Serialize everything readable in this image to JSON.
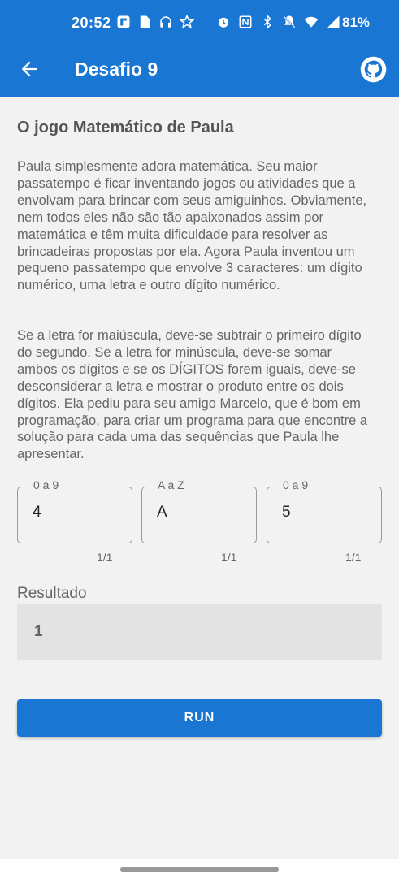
{
  "status_bar": {
    "time": "20:52",
    "battery": "81%",
    "left_icons": [
      "flipboard-icon",
      "document-icon",
      "headset-icon",
      "star-icon"
    ],
    "right_icons": [
      "alarm-icon",
      "nfc-icon",
      "bluetooth-icon",
      "mute-icon",
      "wifi-icon",
      "signal-icon"
    ]
  },
  "app_bar": {
    "title": "Desafio 9",
    "back_icon": "arrow-back-icon",
    "action_icon": "github-icon"
  },
  "challenge": {
    "title": "O jogo Matemático de Paula",
    "paragraph1": "Paula simplesmente adora matemática. Seu maior passatempo é ficar inventando jogos ou atividades que a envolvam para brincar com seus amiguinhos. Obviamente, nem todos eles não são tão apaixonados assim por matemática e têm muita dificuldade para resolver as brincadeiras propostas por ela. Agora Paula inventou um pequeno passatempo que envolve 3 caracteres: um dígito numérico, uma letra e outro dígito numérico.",
    "paragraph2": "Se a letra for maiúscula, deve-se subtrair o primeiro dígito do segundo. Se a letra for minúscula, deve-se somar ambos os dígitos e se os DÍGITOS forem iguais, deve-se desconsiderar a letra e mostrar o produto entre os dois dígitos. Ela pediu para seu amigo Marcelo, que é bom em programação, para criar um programa para que encontre a solução para cada uma das sequências que Paula lhe apresentar."
  },
  "inputs": [
    {
      "label": "0 a 9",
      "value": "4",
      "counter": "1/1"
    },
    {
      "label": "A a Z",
      "value": "A",
      "counter": "1/1"
    },
    {
      "label": "0 a 9",
      "value": "5",
      "counter": "1/1"
    }
  ],
  "result": {
    "label": "Resultado",
    "value": "1"
  },
  "actions": {
    "run_label": "RUN"
  },
  "colors": {
    "primary": "#1976d2",
    "background": "#f2f2f2",
    "result_bg": "#e3e3e3"
  }
}
